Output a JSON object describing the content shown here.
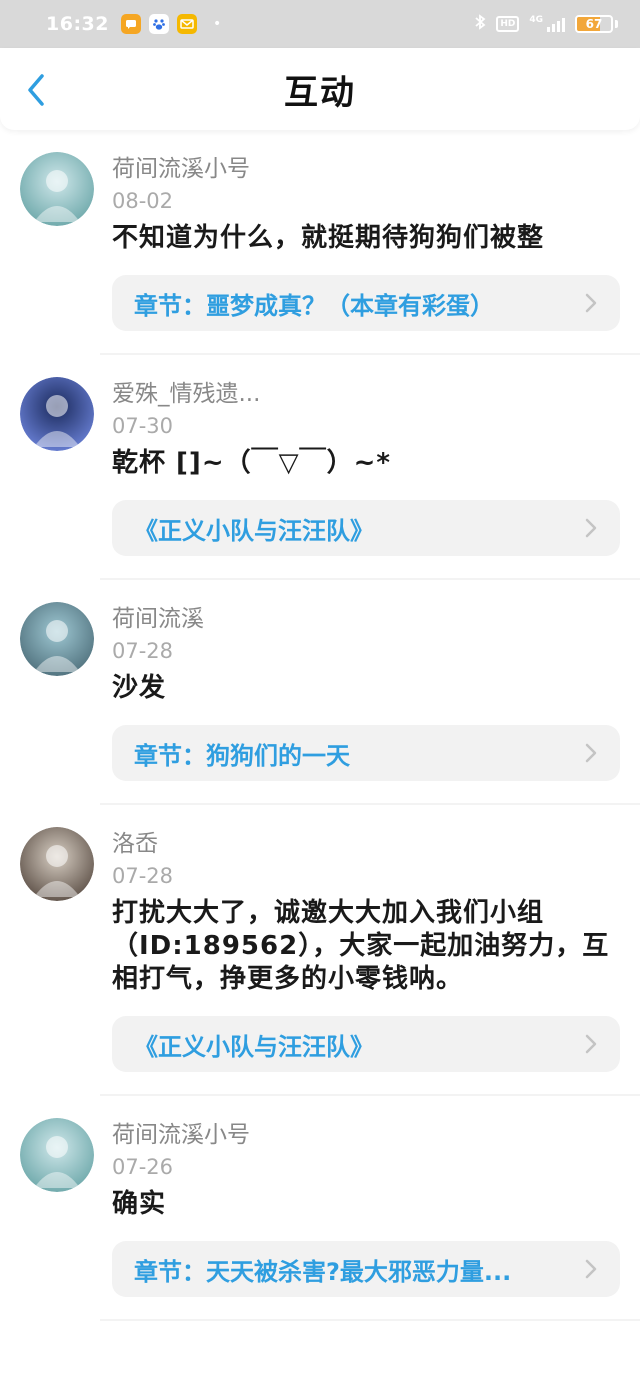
{
  "status_bar": {
    "time": "16:32",
    "network": "4G",
    "battery": "67",
    "battery_level": 0.67,
    "colors": {
      "battery_fill": "#f2a73a",
      "bg": "#d9d9d9"
    }
  },
  "header": {
    "title": "互动"
  },
  "items": [
    {
      "user": "荷间流溪小号",
      "date": "08-02",
      "text": "不知道为什么，就挺期待狗狗们被整",
      "ref": "章节：噩梦成真？（本章有彩蛋）",
      "avatar_colors": [
        "#cfe7ea",
        "#6aa6a8"
      ]
    },
    {
      "user": "爱殊_情残遗...",
      "date": "07-30",
      "text": "乾杯 []~（￣▽￣）~*",
      "ref": "《正义小队与汪汪队》",
      "avatar_colors": [
        "#1b2a5c",
        "#6b82d8"
      ]
    },
    {
      "user": "荷间流溪",
      "date": "07-28",
      "text": "沙发",
      "ref": "章节：狗狗们的一天",
      "avatar_colors": [
        "#9fc8d3",
        "#4d6e7a"
      ]
    },
    {
      "user": "洛岙",
      "date": "07-28",
      "text": "打扰大大了，诚邀大大加入我们小组（ID:189562），大家一起加油努力，互相打气，挣更多的小零钱呐。",
      "ref": "《正义小队与汪汪队》",
      "avatar_colors": [
        "#d8cfc4",
        "#5a4d44"
      ]
    },
    {
      "user": "荷间流溪小号",
      "date": "07-26",
      "text": "确实",
      "ref": "章节：天天被杀害?最大邪恶力量...",
      "avatar_colors": [
        "#cfe7ea",
        "#6aa6a8"
      ]
    }
  ],
  "icons": {
    "back": "chevron-left-icon",
    "ref_arrow": "chevron-right-icon"
  },
  "accent_color": "#2f9ee0"
}
